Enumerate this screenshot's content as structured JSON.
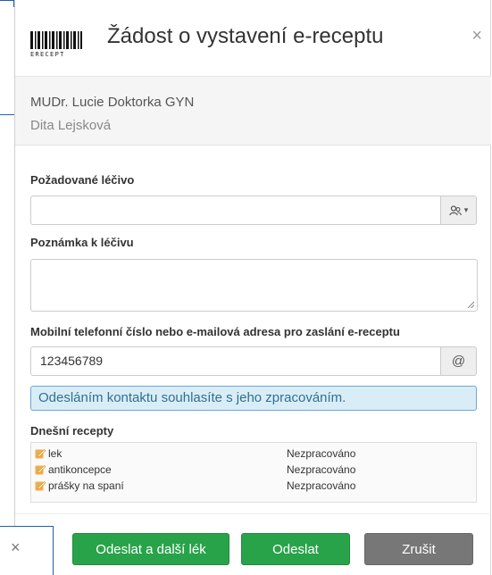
{
  "header": {
    "logo_text": "ERECEPT",
    "title": "Žádost o vystavení e-receptu",
    "close_glyph": "×",
    "close_icon": "close-icon"
  },
  "info": {
    "doctor": "MUDr. Lucie Doktorka GYN",
    "patient": "Dita Lejsková"
  },
  "form": {
    "drug_label": "Požadované léčivo",
    "drug_value": "",
    "drug_addon_icon": "users-icon",
    "drug_addon_caret": "▾",
    "note_label": "Poznámka k léčivu",
    "note_value": "",
    "contact_label": "Mobilní telefonní číslo nebo e-mailová adresa pro zaslání e-receptu",
    "contact_value": "123456789",
    "contact_addon": "@"
  },
  "notice": "Odesláním kontaktu souhlasíte s jeho zpracováním.",
  "recipes": {
    "title": "Dnešní recepty",
    "items": [
      {
        "name": "lek",
        "status": "Nezpracováno"
      },
      {
        "name": "antikoncepce",
        "status": "Nezpracováno"
      },
      {
        "name": "prášky na spaní",
        "status": "Nezpracováno"
      }
    ]
  },
  "footer": {
    "send_next_label": "Odeslat a další lék",
    "send_label": "Odeslat",
    "cancel_label": "Zrušit"
  },
  "background_panel": {
    "close_glyph": "×"
  },
  "colors": {
    "primary_green": "#29a34a",
    "cancel_gray": "#777777",
    "notice_bg": "#d9edf7",
    "notice_border": "#6ea6d8",
    "edit_icon": "#f0ad4e",
    "frame_blue": "#1f5fa8"
  }
}
